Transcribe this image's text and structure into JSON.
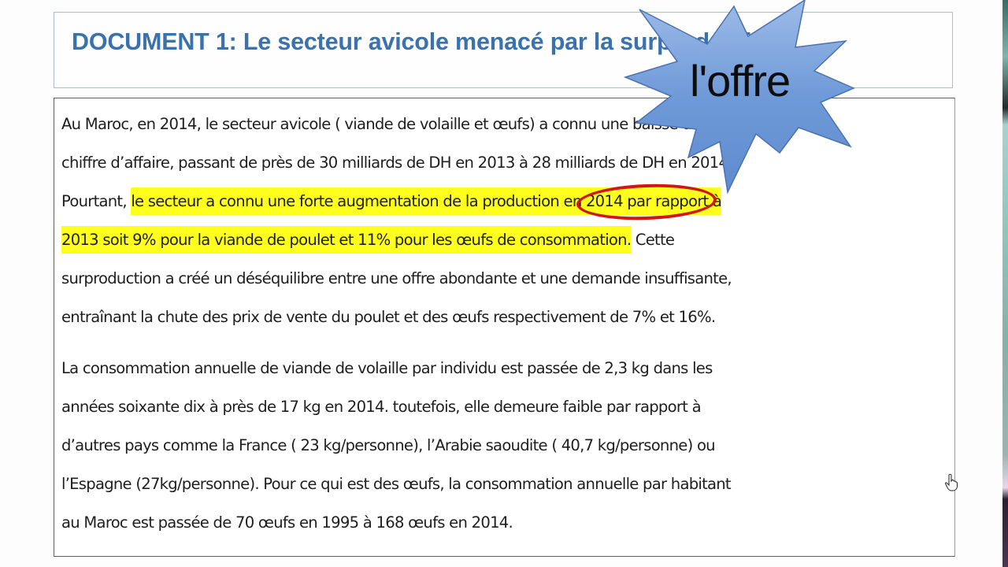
{
  "document": {
    "title": "DOCUMENT 1: Le secteur avicole menacé par la surproduction",
    "paragraph1": {
      "lines": [
        {
          "text": "Au Maroc, en 2014, le secteur avicole ( viande de volaille et œufs) a connu une baisse de son"
        },
        {
          "text": "chiffre d’affaire, passant de près de 30 milliards de DH en 2013 à 28 milliards de DH en 2014."
        },
        {
          "before": "Pourtant, ",
          "highlight_a": "le secteur a connu une forte augmentation de ",
          "circled": "la production",
          "highlight_b": " en 2014 par rapport à"
        },
        {
          "highlight": "2013 soit 9% pour la viande de poulet et 11% pour les œufs de consommation.",
          "after": " Cette"
        },
        {
          "text": "surproduction a créé un déséquilibre entre une offre abondante et une demande insuffisante,"
        },
        {
          "text": "entraînant la chute des prix de vente du poulet et des œufs respectivement de 7% et 16%."
        }
      ]
    },
    "paragraph2": {
      "lines": [
        "La consommation annuelle de viande de volaille par individu est passée de 2,3 kg dans les",
        "années soixante dix à près de 17 kg en 2014. toutefois, elle demeure faible par rapport à",
        "d’autres pays comme la France ( 23 kg/personne), l’Arabie saoudite ( 40,7 kg/personne) ou",
        "l’Espagne (27kg/personne). Pour ce qui est des œufs, la consommation annuelle par habitant",
        "au Maroc est passée de 70 œufs en 1995 à 168 œufs en 2014."
      ]
    }
  },
  "annotations": {
    "starburst_label": "l'offre",
    "starburst_color": "#6f9ad8",
    "highlight_color": "#ffff1e",
    "circle_color": "#d01616"
  },
  "colors": {
    "title": "#3a72ae"
  }
}
